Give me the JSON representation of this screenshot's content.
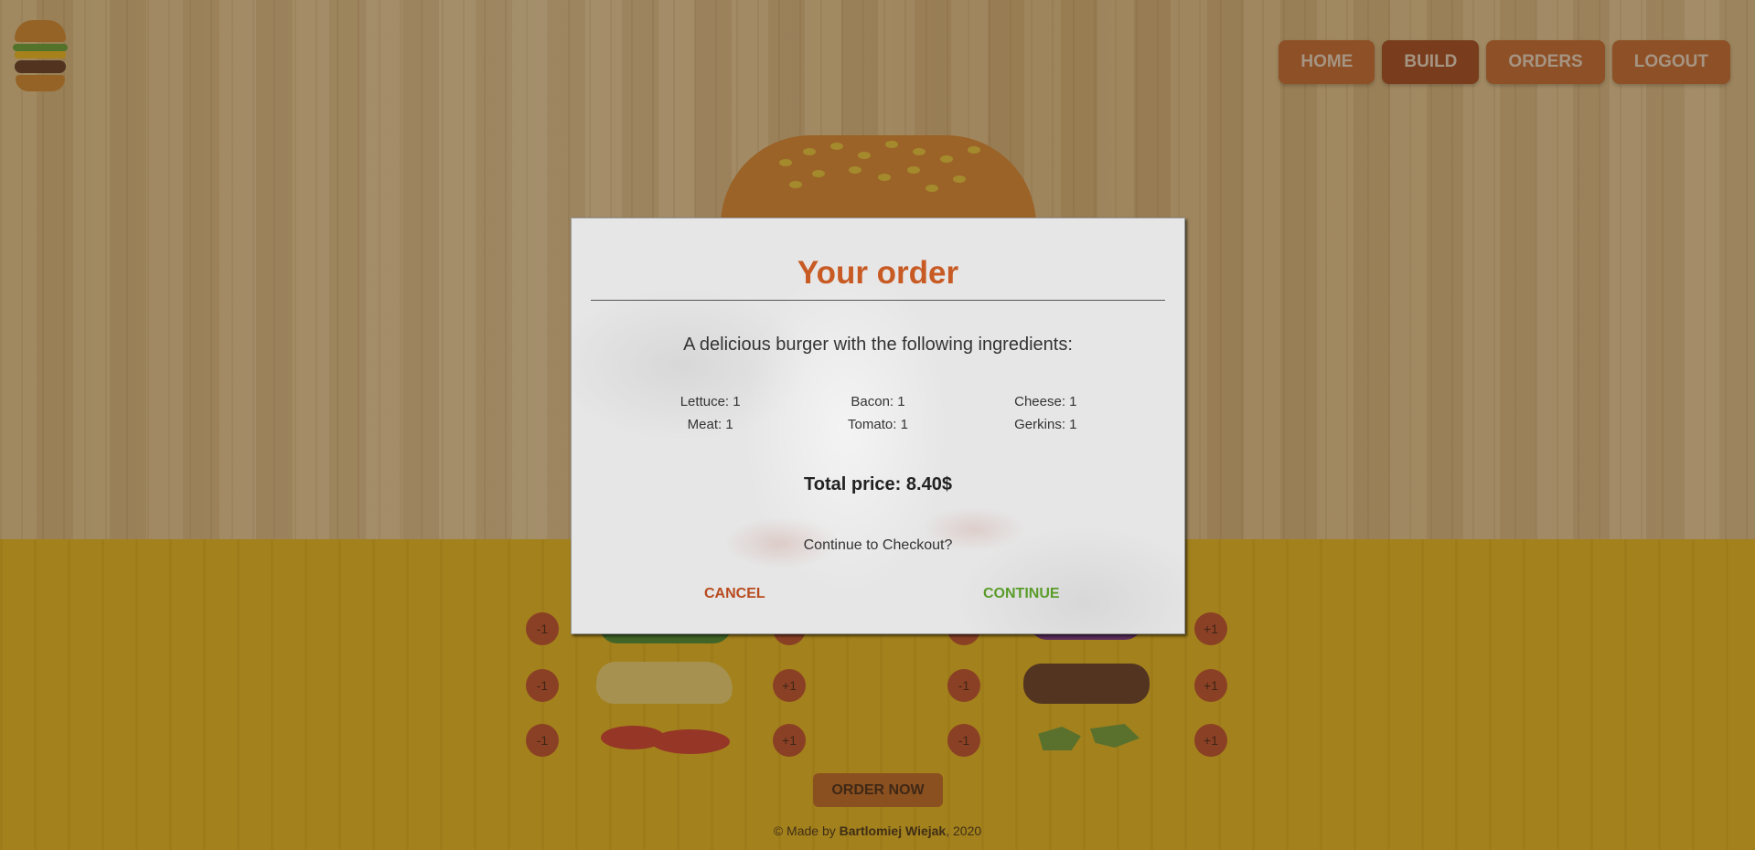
{
  "nav": {
    "items": [
      {
        "label": "HOME",
        "active": false
      },
      {
        "label": "BUILD",
        "active": true
      },
      {
        "label": "ORDERS",
        "active": false
      },
      {
        "label": "LOGOUT",
        "active": false
      }
    ]
  },
  "controls": {
    "minus_label": "-1",
    "plus_label": "+1"
  },
  "order_button": "ORDER NOW",
  "footer": {
    "prefix": "© Made by ",
    "author": "Bartlomiej Wiejak",
    "suffix": ", 2020"
  },
  "modal": {
    "title": "Your order",
    "subtitle": "A delicious burger with the following ingredients:",
    "ingredients": [
      "Lettuce: 1",
      "Bacon: 1",
      "Cheese: 1",
      "Meat: 1",
      "Tomato: 1",
      "Gerkins: 1"
    ],
    "total": "Total price: 8.40$",
    "question": "Continue to Checkout?",
    "cancel_label": "CANCEL",
    "continue_label": "CONTINUE"
  },
  "colors": {
    "accent": "#c85a24",
    "continue": "#5a9c2a",
    "cancel": "#b84a1e"
  }
}
